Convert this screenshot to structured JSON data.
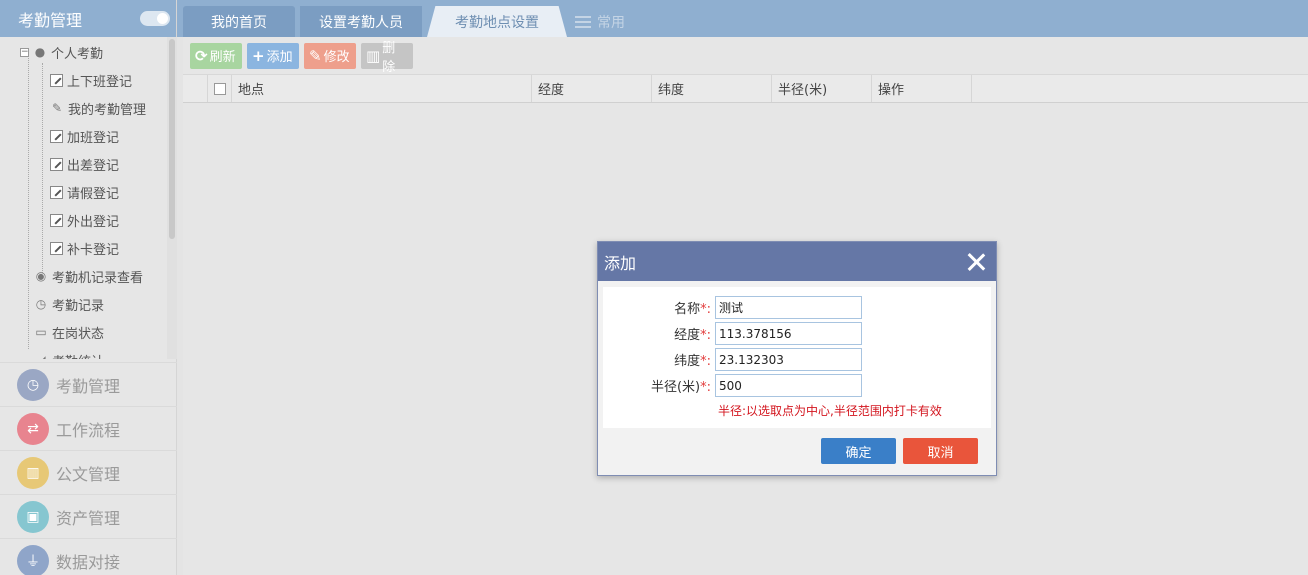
{
  "sidebar": {
    "title": "考勤管理",
    "tree": {
      "root": "个人考勤",
      "children": [
        "上下班登记",
        "我的考勤管理",
        "加班登记",
        "出差登记",
        "请假登记",
        "外出登记",
        "补卡登记"
      ],
      "siblings": [
        "考勤机记录查看",
        "考勤记录",
        "在岗状态",
        "考勤统计"
      ]
    },
    "modules": [
      {
        "label": "考勤管理",
        "color": "#9aa7c4",
        "icon": "clock-icon"
      },
      {
        "label": "工作流程",
        "color": "#e8848f",
        "icon": "flow-icon"
      },
      {
        "label": "公文管理",
        "color": "#e7c876",
        "icon": "document-icon"
      },
      {
        "label": "资产管理",
        "color": "#86c6d0",
        "icon": "asset-icon"
      },
      {
        "label": "数据对接",
        "color": "#8fa5c9",
        "icon": "plug-icon"
      }
    ]
  },
  "tabs": {
    "home": "我的首页",
    "set_people": "设置考勤人员",
    "location": "考勤地点设置",
    "common": "常用"
  },
  "toolbar": {
    "refresh": "刷新",
    "add": "添加",
    "edit": "修改",
    "delete": "删除"
  },
  "grid": {
    "headers": {
      "place": "地点",
      "longitude": "经度",
      "latitude": "纬度",
      "radius": "半径(米)",
      "operation": "操作"
    }
  },
  "dialog": {
    "title": "添加",
    "fields": {
      "name_label": "名称",
      "name_value": "测试",
      "lng_label": "经度",
      "lng_value": "113.378156",
      "lat_label": "纬度",
      "lat_value": "23.132303",
      "radius_label": "半径(米)",
      "radius_value": "500",
      "required_mark": "*:"
    },
    "hint": "半径:以选取点为中心,半径范围内打卡有效",
    "ok": "确定",
    "cancel": "取消"
  }
}
